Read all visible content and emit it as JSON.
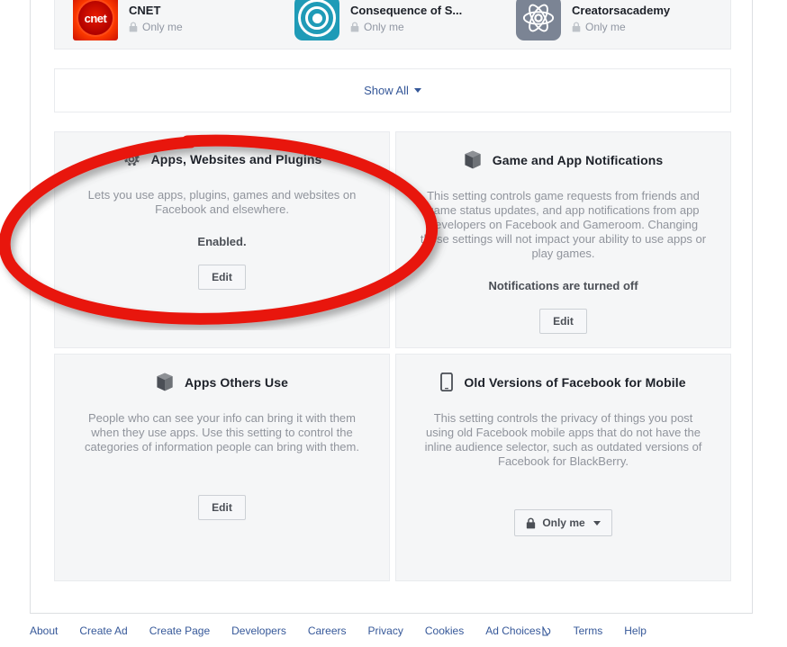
{
  "apps_panel": {
    "tiles": [
      {
        "name": "CNET",
        "privacy": "Only me",
        "icon": "cnet-icon"
      },
      {
        "name": "Consequence of S...",
        "privacy": "Only me",
        "icon": "consequence-of-sound-icon"
      },
      {
        "name": "Creatorsacademy",
        "privacy": "Only me",
        "icon": "creatorsacademy-icon"
      }
    ],
    "show_all_label": "Show All"
  },
  "cards": [
    {
      "title": "Apps, Websites and Plugins",
      "icon": "gear-icon",
      "description": "Lets you use apps, plugins, games and websites on Facebook and elsewhere.",
      "status": "Enabled.",
      "button_label": "Edit"
    },
    {
      "title": "Game and App Notifications",
      "icon": "cube-icon",
      "description": "This setting controls game requests from friends and game status updates, and app notifications from app developers on Facebook and Gameroom. Changing these settings will not impact your ability to use apps or play games.",
      "status": "Notifications are turned off",
      "button_label": "Edit"
    },
    {
      "title": "Apps Others Use",
      "icon": "cube-icon",
      "description": "People who can see your info can bring it with them when they use apps. Use this setting to control the categories of information people can bring with them.",
      "status": "",
      "button_label": "Edit"
    },
    {
      "title": "Old Versions of Facebook for Mobile",
      "icon": "mobile-icon",
      "description": "This setting controls the privacy of things you post using old Facebook mobile apps that do not have the inline audience selector, such as outdated versions of Facebook for BlackBerry.",
      "status": "",
      "button_label": "Only me"
    }
  ],
  "annotation": {
    "shape": "ellipse",
    "color": "#e8190f"
  },
  "footer": {
    "links": [
      "About",
      "Create Ad",
      "Create Page",
      "Developers",
      "Careers",
      "Privacy",
      "Cookies",
      "Ad Choices",
      "Terms",
      "Help"
    ]
  },
  "colors": {
    "link": "#365899",
    "panel_bg": "#f5f6f7",
    "border": "#e9ebee",
    "title_text": "#1d2129",
    "muted_text": "#90949c",
    "annotation_red": "#e8190f"
  }
}
